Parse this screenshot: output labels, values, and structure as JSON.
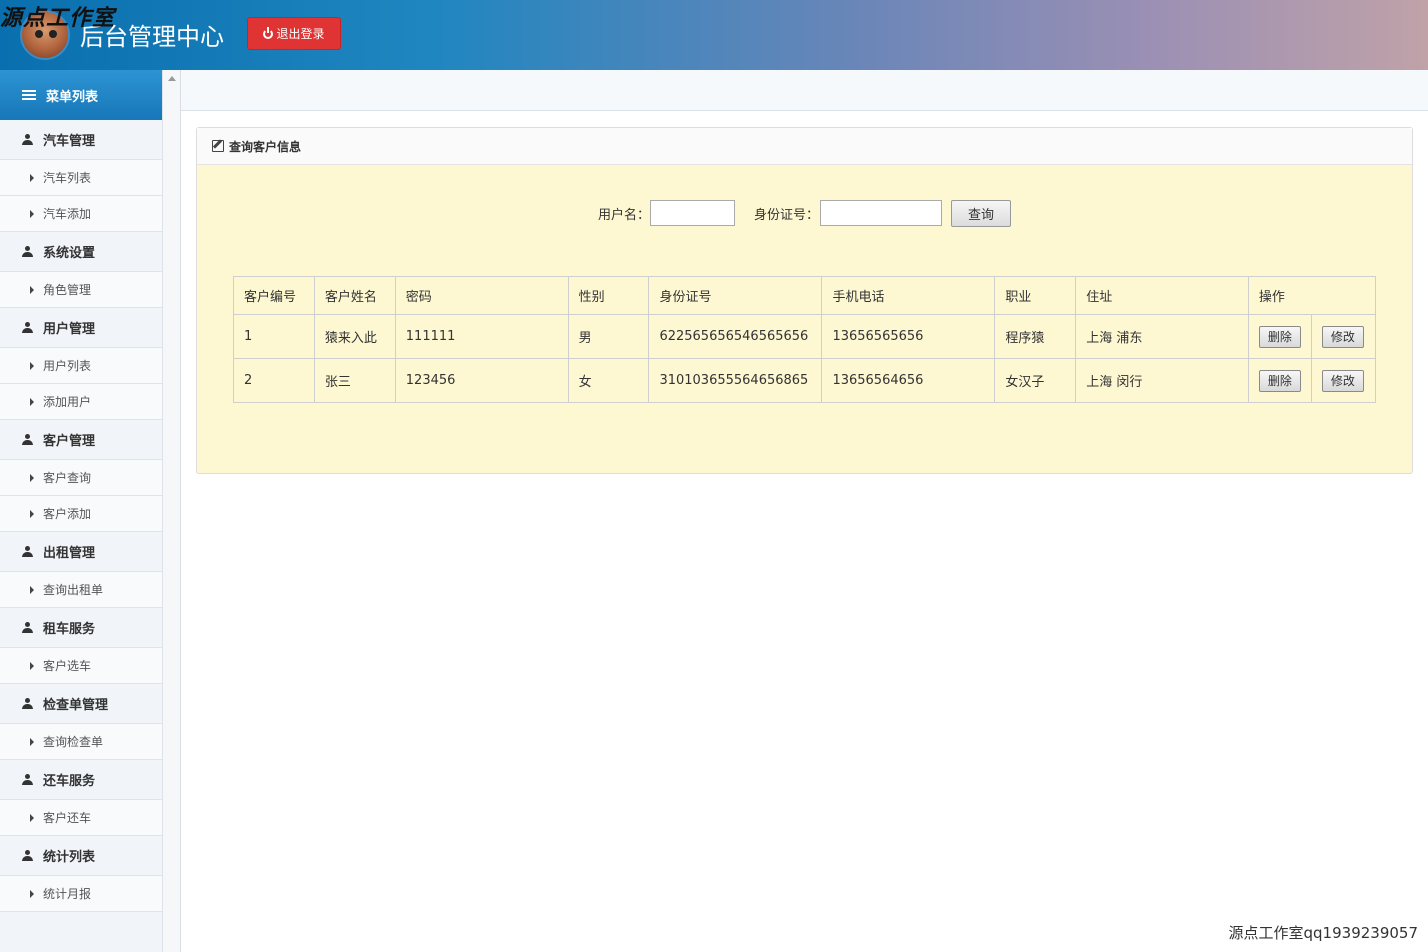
{
  "watermark_top": "源点工作室",
  "header": {
    "title": "后台管理中心",
    "logout_label": "退出登录"
  },
  "sidebar": {
    "menu_title": "菜单列表",
    "groups": [
      {
        "label": "汽车管理",
        "items": [
          "汽车列表",
          "汽车添加"
        ]
      },
      {
        "label": "系统设置",
        "items": [
          "角色管理"
        ]
      },
      {
        "label": "用户管理",
        "items": [
          "用户列表",
          "添加用户"
        ]
      },
      {
        "label": "客户管理",
        "items": [
          "客户查询",
          "客户添加"
        ]
      },
      {
        "label": "出租管理",
        "items": [
          "查询出租单"
        ]
      },
      {
        "label": "租车服务",
        "items": [
          "客户选车"
        ]
      },
      {
        "label": "检查单管理",
        "items": [
          "查询检查单"
        ]
      },
      {
        "label": "还车服务",
        "items": [
          "客户还车"
        ]
      },
      {
        "label": "统计列表",
        "items": [
          "统计月报"
        ]
      }
    ]
  },
  "panel": {
    "title": "查询客户信息",
    "search": {
      "username_label": "用户名：",
      "username_value": "",
      "idcard_label": "身份证号：",
      "idcard_value": "",
      "query_label": "查询"
    },
    "table": {
      "headers": [
        "客户编号",
        "客户姓名",
        "密码",
        "性别",
        "身份证号",
        "手机电话",
        "职业",
        "住址",
        "操作"
      ],
      "rows": [
        [
          "1",
          "猿来入此",
          "111111",
          "男",
          "622565656546565656",
          "13656565656",
          "程序猿",
          "上海 浦东"
        ],
        [
          "2",
          "张三",
          "123456",
          "女",
          "310103655564656865",
          "13656564656",
          "女汉子",
          "上海 闵行"
        ]
      ],
      "delete_label": "删除",
      "edit_label": "修改"
    }
  },
  "watermark_bottom": "源点工作室qq1939239057",
  "colors": {
    "logout": "#e03434",
    "panel_bg": "#fdf7d2",
    "menu_header": "#1777b8"
  }
}
